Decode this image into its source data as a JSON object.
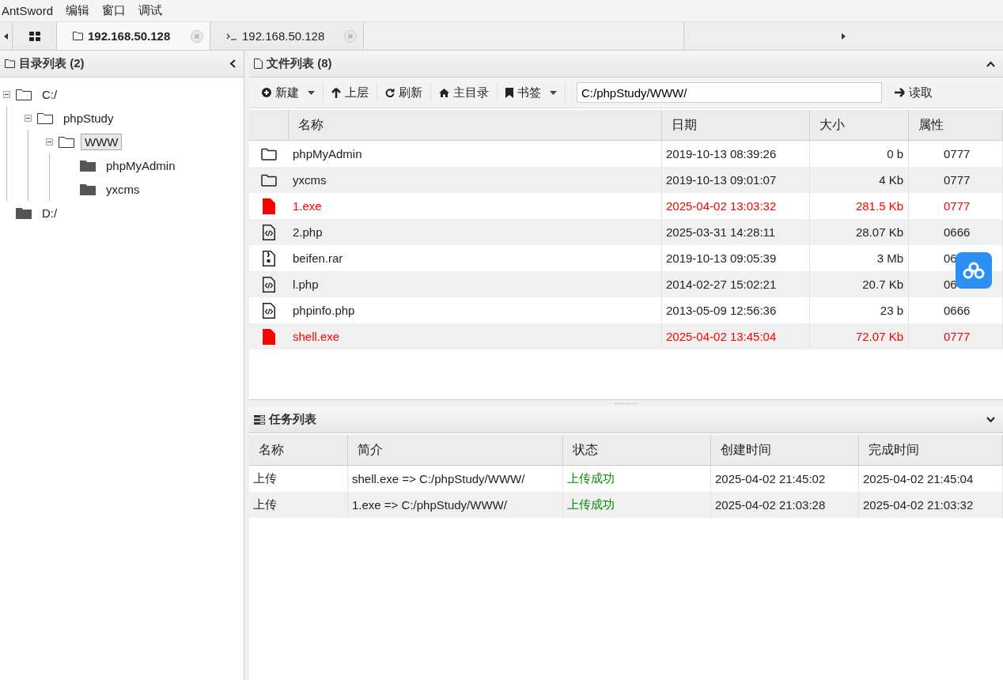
{
  "menu": [
    "AntSword",
    "编辑",
    "窗口",
    "调试"
  ],
  "tabs": [
    {
      "kind": "home",
      "selected": false
    },
    {
      "kind": "files",
      "label": "192.168.50.128",
      "selected": true
    },
    {
      "kind": "terminal",
      "label": "192.168.50.128",
      "selected": false
    }
  ],
  "dir_panel": {
    "title": "目录列表 (2)",
    "tree": [
      {
        "label": "C:/",
        "expanded": true,
        "selected": false,
        "children": [
          {
            "label": "phpStudy",
            "expanded": true,
            "selected": false,
            "children": [
              {
                "label": "WWW",
                "expanded": true,
                "selected": true,
                "children": [
                  {
                    "label": "phpMyAdmin",
                    "expanded": false,
                    "selected": false
                  },
                  {
                    "label": "yxcms",
                    "expanded": false,
                    "selected": false
                  }
                ]
              }
            ]
          }
        ]
      },
      {
        "label": "D:/",
        "expanded": false,
        "selected": false
      }
    ]
  },
  "file_panel": {
    "title": "文件列表 (8)",
    "toolbar": [
      {
        "kind": "new",
        "label": "新建",
        "dropdown": true
      },
      {
        "kind": "up",
        "label": "上层",
        "dropdown": false
      },
      {
        "kind": "refresh",
        "label": "刷新",
        "dropdown": false
      },
      {
        "kind": "home",
        "label": "主目录",
        "dropdown": false
      },
      {
        "kind": "bookmark",
        "label": "书签",
        "dropdown": true
      }
    ],
    "path": "C:/phpStudy/WWW/",
    "read_button": "读取",
    "columns": [
      "名称",
      "日期",
      "大小",
      "属性"
    ],
    "rows": [
      {
        "kind": "folder",
        "name": "phpMyAdmin",
        "date": "2019-10-13 08:39:26",
        "size": "0 b",
        "attr": "0777"
      },
      {
        "kind": "folder",
        "name": "yxcms",
        "date": "2019-10-13 09:01:07",
        "size": "4 Kb",
        "attr": "0777"
      },
      {
        "kind": "exe",
        "name": "1.exe",
        "date": "2025-04-02 13:03:32",
        "size": "281.5 Kb",
        "attr": "0777"
      },
      {
        "kind": "code",
        "name": "2.php",
        "date": "2025-03-31 14:28:11",
        "size": "28.07 Kb",
        "attr": "0666"
      },
      {
        "kind": "archive",
        "name": "beifen.rar",
        "date": "2019-10-13 09:05:39",
        "size": "3 Mb",
        "attr": "06"
      },
      {
        "kind": "code",
        "name": "l.php",
        "date": "2014-02-27 15:02:21",
        "size": "20.7 Kb",
        "attr": "06"
      },
      {
        "kind": "code",
        "name": "phpinfo.php",
        "date": "2013-05-09 12:56:36",
        "size": "23 b",
        "attr": "0666"
      },
      {
        "kind": "exe",
        "name": "shell.exe",
        "date": "2025-04-02 13:45:04",
        "size": "72.07 Kb",
        "attr": "0777"
      }
    ]
  },
  "task_panel": {
    "title": "任务列表",
    "columns": [
      "名称",
      "简介",
      "状态",
      "创建时间",
      "完成时间"
    ],
    "rows": [
      {
        "name": "上传",
        "desc": "shell.exe => C:/phpStudy/WWW/",
        "status": "上传成功",
        "status_ok": true,
        "created": "2025-04-02 21:45:02",
        "finished": "2025-04-02 21:45:04"
      },
      {
        "name": "上传",
        "desc": "1.exe => C:/phpStudy/WWW/",
        "status": "上传成功",
        "status_ok": true,
        "created": "2025-04-02 21:03:28",
        "finished": "2025-04-02 21:03:32"
      }
    ]
  },
  "floating_widget": {
    "kind": "cloud"
  }
}
